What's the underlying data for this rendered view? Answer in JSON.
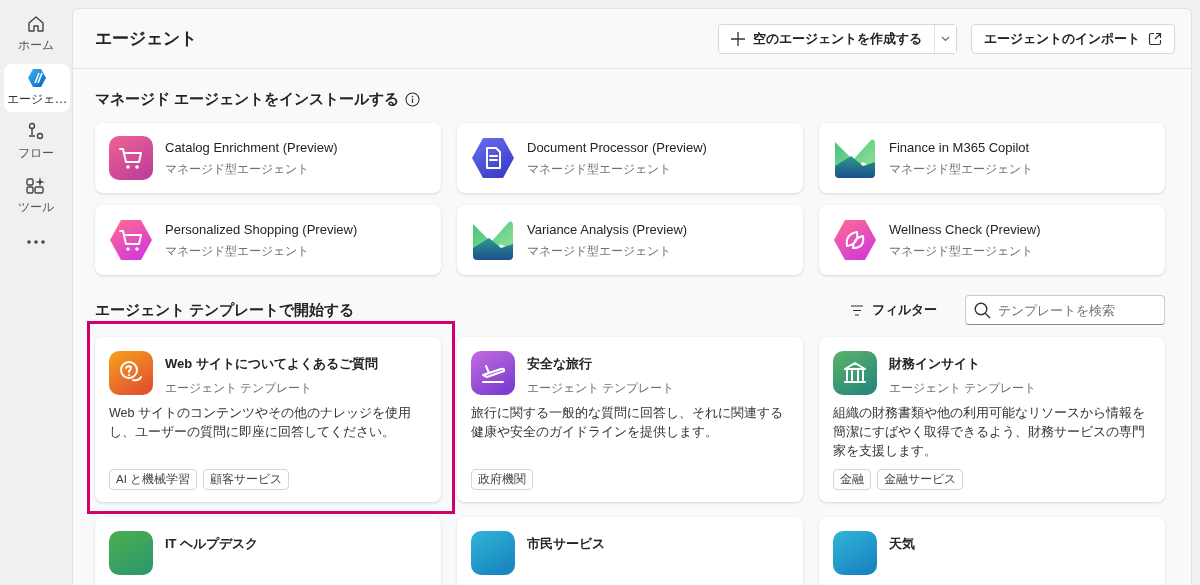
{
  "sidebar": {
    "items": [
      {
        "label": "ホーム",
        "selected": false
      },
      {
        "label": "エージェ…",
        "selected": true
      },
      {
        "label": "フロー",
        "selected": false
      },
      {
        "label": "ツール",
        "selected": false
      }
    ]
  },
  "header": {
    "title": "エージェント",
    "create_button": "空のエージェントを作成する",
    "import_button": "エージェントのインポート"
  },
  "managed": {
    "title": "マネージド エージェントをインストールする",
    "agents": [
      {
        "name": "Catalog Enrichment (Preview)",
        "subtitle": "マネージド型エージェント"
      },
      {
        "name": "Document Processor (Preview)",
        "subtitle": "マネージド型エージェント"
      },
      {
        "name": "Finance in M365 Copilot",
        "subtitle": "マネージド型エージェント"
      },
      {
        "name": "Personalized Shopping (Preview)",
        "subtitle": "マネージド型エージェント"
      },
      {
        "name": "Variance Analysis (Preview)",
        "subtitle": "マネージド型エージェント"
      },
      {
        "name": "Wellness Check (Preview)",
        "subtitle": "マネージド型エージェント"
      }
    ]
  },
  "templates": {
    "title": "エージェント テンプレートで開始する",
    "filter_label": "フィルター",
    "search": {
      "placeholder": "テンプレートを検索"
    },
    "items": [
      {
        "name": "Web サイトについてよくあるご質問",
        "subtitle": "エージェント テンプレート",
        "description": "Web サイトのコンテンツやその他のナレッジを使用し、ユーザーの質問に即座に回答してください。",
        "tags": [
          "AI と機械学習",
          "顧客サービス"
        ],
        "highlighted": true
      },
      {
        "name": "安全な旅行",
        "subtitle": "エージェント テンプレート",
        "description": "旅行に関する一般的な質問に回答し、それに関連する健康や安全のガイドラインを提供します。",
        "tags": [
          "政府機関"
        ],
        "highlighted": false
      },
      {
        "name": "財務インサイト",
        "subtitle": "エージェント テンプレート",
        "description": "組織の財務書類や他の利用可能なリソースから情報を簡潔にすばやく取得できるよう、財務サービスの専門家を支援します。",
        "tags": [
          "金融",
          "金融サービス"
        ],
        "highlighted": false
      },
      {
        "name": "IT ヘルプデスク",
        "highlighted": false
      },
      {
        "name": "市民サービス",
        "highlighted": false
      },
      {
        "name": "天気",
        "highlighted": false
      }
    ]
  }
}
